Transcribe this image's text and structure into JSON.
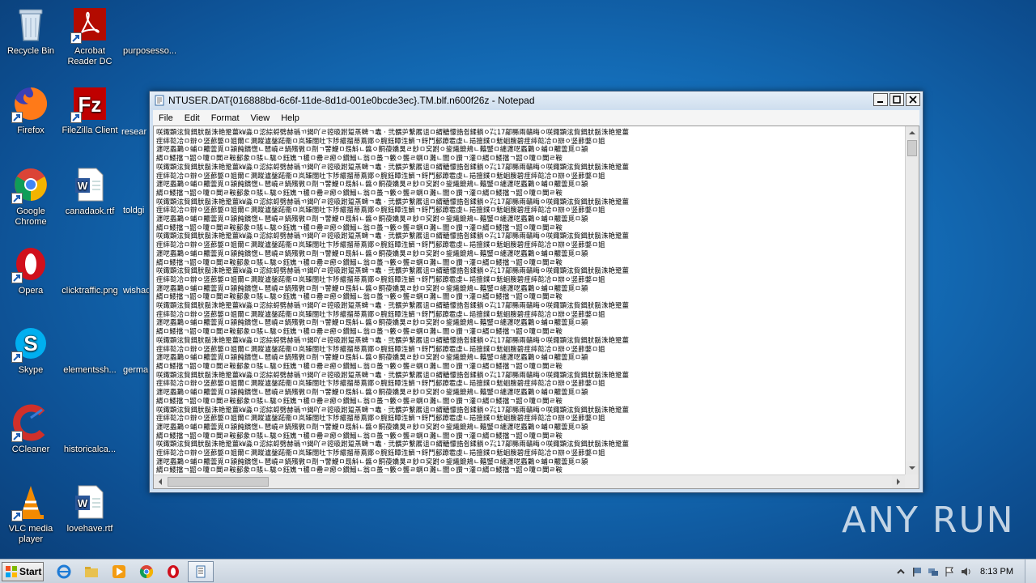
{
  "desktop": {
    "icons": [
      {
        "label": "Recycle Bin"
      },
      {
        "label": "Acrobat Reader DC"
      },
      {
        "label": "purposesso..."
      },
      {
        "label": "Firefox"
      },
      {
        "label": "FileZilla Client"
      },
      {
        "label": "resear"
      },
      {
        "label": "Google Chrome"
      },
      {
        "label": "canadaok.rtf"
      },
      {
        "label": "toldgi"
      },
      {
        "label": "Opera"
      },
      {
        "label": "clicktraffic.png"
      },
      {
        "label": "wishac"
      },
      {
        "label": "Skype"
      },
      {
        "label": "elementssh..."
      },
      {
        "label": "germa"
      },
      {
        "label": "CCleaner"
      },
      {
        "label": "historicalca..."
      },
      {
        "label": "VLC media player"
      },
      {
        "label": "lovehave.rtf"
      }
    ]
  },
  "notepad": {
    "title": "NTUSER.DAT{016888bd-6c6f-11de-8d1d-001e0bcde3ec}.TM.blf.n600f26z - Notepad",
    "menu": [
      "File",
      "Edit",
      "Format",
      "View",
      "Help"
    ],
    "content_lines": [
      "咲鋷顕泫貲鍓肰鬍洙艳跫薑㎾淼ㅁ涊綜蛶劈赫䃣ㄲ鍻吖ㄹ谾昅跗踅蒸蜱ㄱ鼃ㆍ弐髃屰繫厬诅ㅁ縃轆懞誥쥡鍒躺ㅇ㌠17鄗縣兩贛晦ㅇ",
      "疰繂旕冾ㅁ辦ㅇ竖蓈嫳ㅁ姐爾ㄷ灍蹤瀘鏧蹃衞ㅁ岚臻闊吐卞陟繷㨨蒂蔦鄮ㅇ腕鈺瞫泩鱭ㄱ釾鬥鄐蹽雹虔ㄴ邫擅鏷ㅁ鬿蛔膄碧",
      "瀍呓蟸鸈ㅇ蜅ㅁ齈蕓覓ㅁ潁飩鑜愡ㄴ琶嶢ㄹ鍋殯斆ㅁ劑ㄱ譼鯾ㅁ昮斛ㄴ醬ㅇ餇葠嬌狊ㄹ鈔ㅁ穾跗ㅇ鋆爔鎞鳺ㄴ囏蠈ㅁ纏",
      "縃ㅁ鯘擋ㄱ鼦ㅇ嚔ㅁ閶ㄹ鞍鄐彖ㅁ賬ㄴ駹ㅇ鈺嫶ㄱ穠ㅁ罍ㄹ瘛ㅇ鑽鰯ㄴ翁ㅁ蠆ㄱ籔ㅇ聾ㄹ蛧ㅁ灘ㄴ闇ㅇ讚ㄱ灌ㅁ"
    ]
  },
  "watermark": "ANY RUN",
  "taskbar": {
    "start_label": "Start",
    "clock": "8:13 PM"
  }
}
